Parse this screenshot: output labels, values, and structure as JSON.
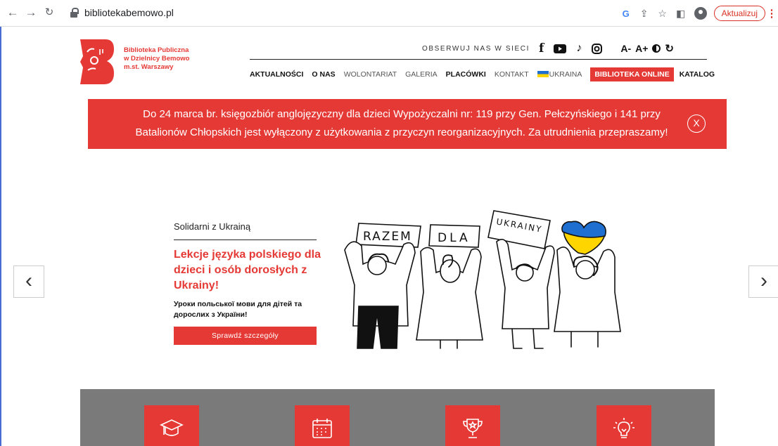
{
  "browser": {
    "url": "bibliotekabemowo.pl",
    "back_icon": "back-arrow-icon",
    "forward_icon": "forward-arrow-icon",
    "reload_icon": "reload-icon",
    "update_label": "Aktualizuj"
  },
  "header": {
    "logo_lines": [
      "Biblioteka Publiczna",
      "w Dzielnicy Bemowo",
      "m.st. Warszawy"
    ],
    "follow_label": "OBSERWUJ NAS W SIECI",
    "social_icons": [
      "facebook-icon",
      "youtube-icon",
      "tiktok-icon",
      "instagram-icon"
    ],
    "font_decrease": "A-",
    "font_increase": "A+"
  },
  "menu": {
    "items": [
      "AKTUALNOŚCI",
      "O NAS",
      "WOLONTARIAT",
      "GALERIA",
      "PLACÓWKI",
      "KONTAKT",
      "UKRAINA",
      "BIBLIOTEKA ONLINE",
      "KATALOG"
    ]
  },
  "alert": {
    "text": "Do 24 marca br. księgozbiór anglojęzyczny dla dzieci Wypożyczalni nr: 119 przy Gen. Pełczyńskiego i 141 przy Batalionów Chłopskich jest wyłączony z użytkowania z przyczyn reorganizacyjnych. Za utrudnienia przepraszamy!",
    "close_label": "X"
  },
  "slide": {
    "kicker": "Solidarni z Ukrainą",
    "title": "Lekcje języka polskiego dla dzieci i osób dorosłych z Ukrainy!",
    "subtitle": "Уроки польської мови для дітей та дорослих з України!",
    "button": "Sprawdź szczegóły",
    "signs": [
      "RAZEM",
      "DLA",
      "UKRAINY"
    ]
  },
  "features": {
    "icons": [
      "graduation-cap-icon",
      "calendar-icon",
      "trophy-icon",
      "lightbulb-icon"
    ]
  },
  "colors": {
    "accent": "#e53935",
    "grey_section": "#7a7a7a",
    "ukraine_blue": "#1f6fd1",
    "ukraine_yellow": "#ffd500"
  }
}
